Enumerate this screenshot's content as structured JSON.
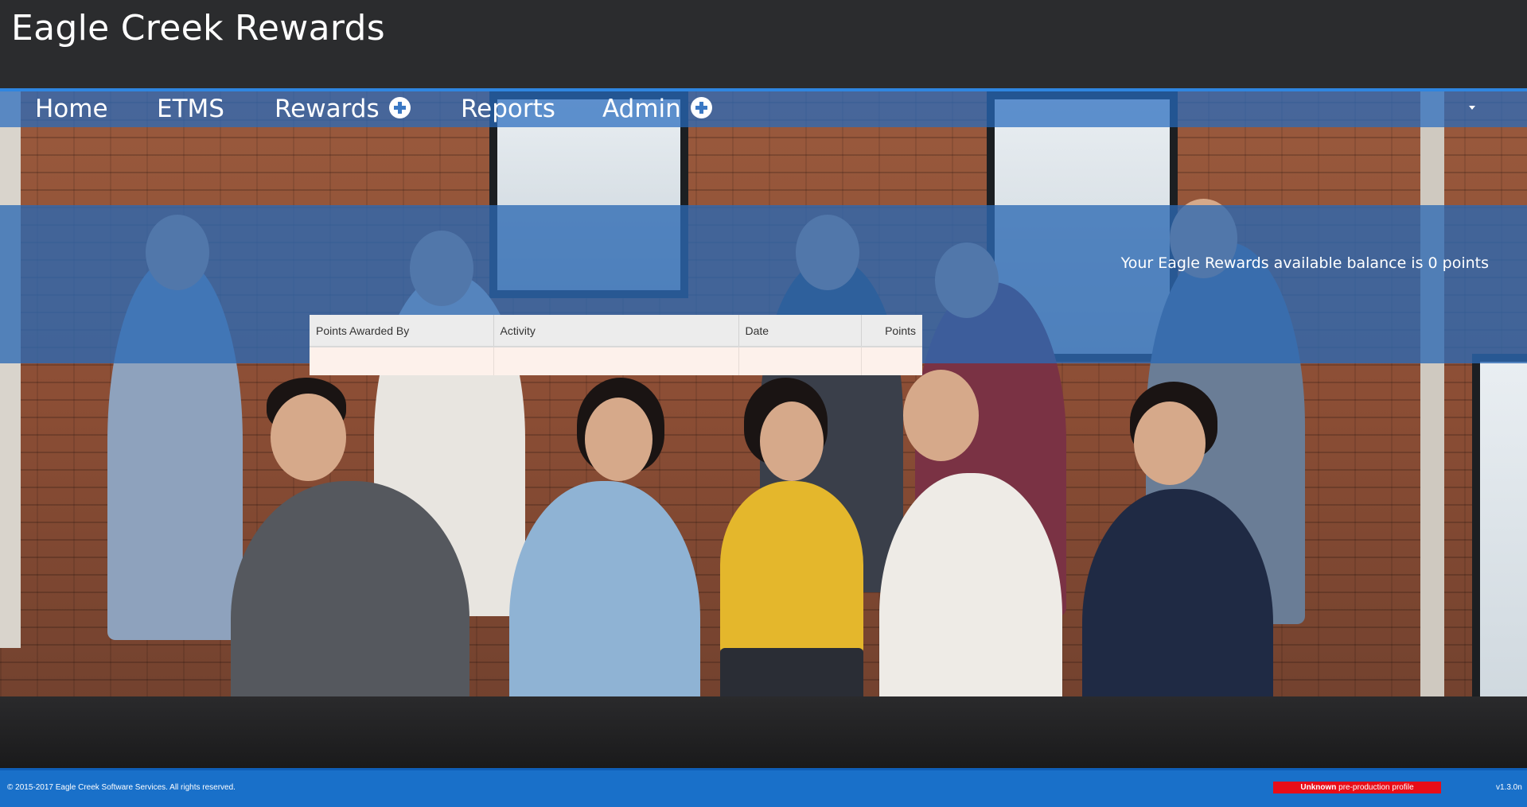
{
  "app": {
    "title": "Eagle Creek Rewards"
  },
  "nav": {
    "items": [
      {
        "label": "Home",
        "has_submenu": false
      },
      {
        "label": "ETMS",
        "has_submenu": false
      },
      {
        "label": "Rewards",
        "has_submenu": true
      },
      {
        "label": "Reports",
        "has_submenu": false
      },
      {
        "label": "Admin",
        "has_submenu": true
      }
    ],
    "submenu_icon": "plus-circle-icon",
    "overflow_icon": "caret-down-icon"
  },
  "balance": {
    "text": "Your Eagle Rewards available balance is 0 points"
  },
  "table": {
    "columns": [
      "Points Awarded By",
      "Activity",
      "Date",
      "Points"
    ],
    "rows": [
      [
        "",
        "",
        "",
        ""
      ]
    ]
  },
  "footer": {
    "copyright": "© 2015-2017 Eagle Creek Software Services. All rights reserved.",
    "profile_bold": "Unknown",
    "profile_rest": " pre-production profile",
    "version": "v1.3.0n"
  },
  "colors": {
    "header_bg": "#2b2c2e",
    "accent_blue": "#2f86e0",
    "badge_red": "#e80d18"
  }
}
